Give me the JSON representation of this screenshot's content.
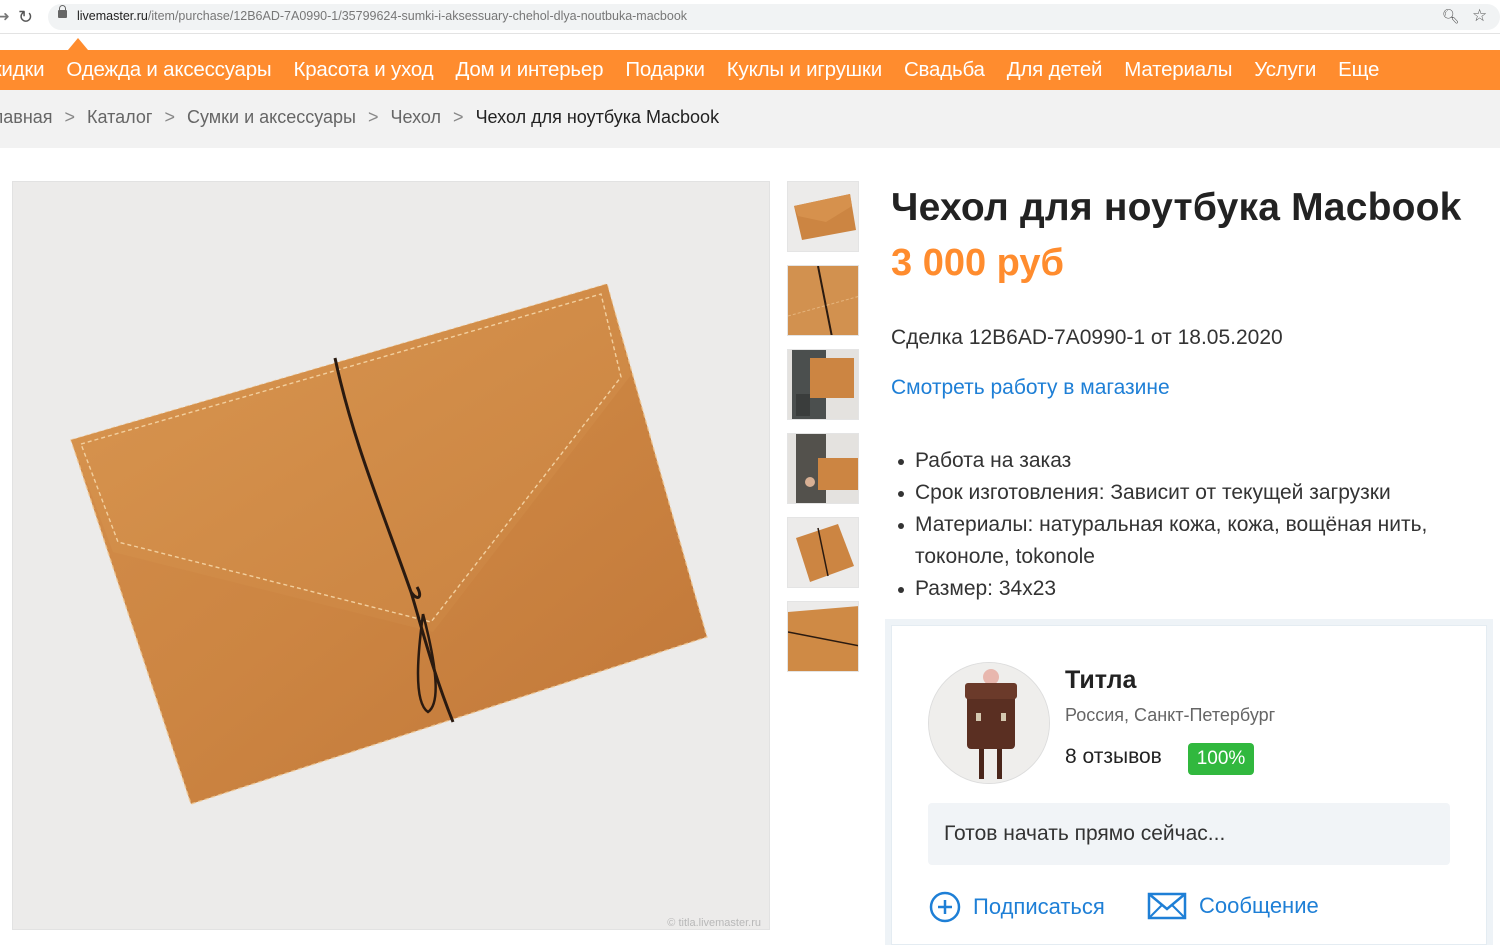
{
  "browser": {
    "url_host": "livemaster.ru",
    "url_path": "/item/purchase/12B6AD-7A0990-1/35799624-sumki-i-aksessuary-chehol-dlya-noutbuka-macbook"
  },
  "nav": {
    "items": [
      "Скидки",
      "Одежда и аксессуары",
      "Красота и уход",
      "Дом и интерьер",
      "Подарки",
      "Куклы и игрушки",
      "Свадьба",
      "Для детей",
      "Материалы",
      "Услуги",
      "Еще"
    ]
  },
  "breadcrumb": {
    "items": [
      "Главная",
      "Каталог",
      "Сумки и аксессуары",
      "Чехол"
    ],
    "current": "Чехол для ноутбука Macbook",
    "separator": ">"
  },
  "product": {
    "title": "Чехол для ноутбука Macbook",
    "price": "3 000 руб",
    "deal": "Сделка 12B6AD-7A0990-1 от 18.05.2020",
    "shop_link": "Смотреть работу в магазине",
    "properties": [
      "Работа на заказ",
      "Срок изготовления: Зависит от текущей загрузки",
      "Материалы: натуральная кожа, кожа, вощёная нить, токоноле, tokonole",
      "Размер: 34x23"
    ],
    "watermark": "© titla.livemaster.ru",
    "thumbnail_count": 6
  },
  "seller": {
    "name": "Титла",
    "location": "Россия, Санкт-Петербург",
    "reviews": "8 отзывов",
    "rating": "100%",
    "status": "Готов начать прямо сейчас...",
    "subscribe_label": "Подписаться",
    "message_label": "Сообщение"
  },
  "colors": {
    "accent": "#ff8c2e",
    "link": "#1e7fd6",
    "rating_badge": "#31b83e",
    "leather": "#cc8542"
  },
  "icons": {
    "subscribe": "plus-circle-icon",
    "message": "envelope-icon",
    "zoom": "zoom-icon",
    "bookmark": "star-icon",
    "reload": "reload-icon",
    "lock": "lock-icon"
  }
}
